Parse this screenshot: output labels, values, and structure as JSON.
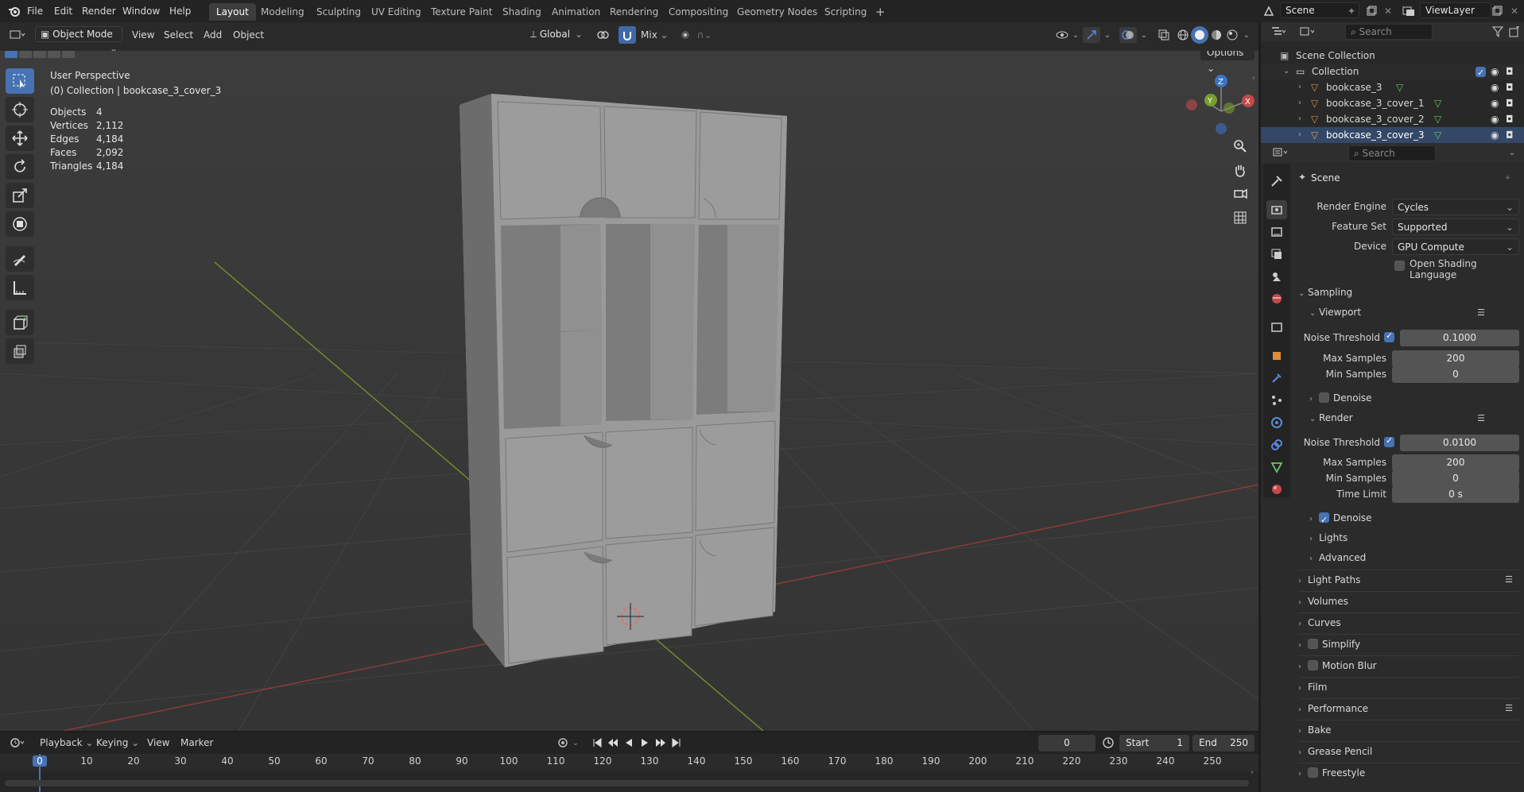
{
  "menus": [
    "File",
    "Edit",
    "Render",
    "Window",
    "Help"
  ],
  "workspaces": [
    "Layout",
    "Modeling",
    "Sculpting",
    "UV Editing",
    "Texture Paint",
    "Shading",
    "Animation",
    "Rendering",
    "Compositing",
    "Geometry Nodes",
    "Scripting"
  ],
  "scene_name": "Scene",
  "view_layer": "ViewLayer",
  "header": {
    "mode": "Object Mode",
    "view": "View",
    "select": "Select",
    "add": "Add",
    "object": "Object",
    "orientation": "Global",
    "pivot": "Mix",
    "options": "Options"
  },
  "overlay": {
    "perspective": "User Perspective",
    "collection": "(0) Collection | bookcase_3_cover_3"
  },
  "stats": [
    {
      "label": "Objects",
      "value": "4"
    },
    {
      "label": "Vertices",
      "value": "2,112"
    },
    {
      "label": "Edges",
      "value": "4,184"
    },
    {
      "label": "Faces",
      "value": "2,092"
    },
    {
      "label": "Triangles",
      "value": "4,184"
    }
  ],
  "outliner": {
    "search_placeholder": "Search",
    "root": "Scene Collection",
    "collection": "Collection",
    "items": [
      "bookcase_3",
      "bookcase_3_cover_1",
      "bookcase_3_cover_2",
      "bookcase_3_cover_3"
    ]
  },
  "properties": {
    "search_placeholder": "Search",
    "title": "Scene",
    "render_engine_label": "Render Engine",
    "render_engine": "Cycles",
    "feature_set_label": "Feature Set",
    "feature_set": "Supported",
    "device_label": "Device",
    "device": "GPU Compute",
    "osl_label": "Open Shading Language",
    "sampling": "Sampling",
    "viewport": "Viewport",
    "noise_threshold_label": "Noise Threshold",
    "vp_noise": "0.1000",
    "max_samples_label": "Max Samples",
    "vp_max": "200",
    "min_samples_label": "Min Samples",
    "vp_min": "0",
    "denoise_label": "Denoise",
    "render": "Render",
    "r_noise": "0.0100",
    "r_max": "200",
    "r_min": "0",
    "time_limit_label": "Time Limit",
    "r_time": "0 s",
    "lights": "Lights",
    "advanced": "Advanced",
    "sections": [
      "Light Paths",
      "Volumes",
      "Curves",
      "Simplify",
      "Motion Blur",
      "Film",
      "Performance",
      "Bake",
      "Grease Pencil",
      "Freestyle"
    ]
  },
  "timeline": {
    "playback": "Playback",
    "keying": "Keying",
    "view": "View",
    "marker": "Marker",
    "current": "0",
    "start_label": "Start",
    "start": "1",
    "end_label": "End",
    "end": "250",
    "ticks": [
      "0",
      "10",
      "20",
      "30",
      "40",
      "50",
      "60",
      "70",
      "80",
      "90",
      "100",
      "110",
      "120",
      "130",
      "140",
      "150",
      "160",
      "170",
      "180",
      "190",
      "200",
      "210",
      "220",
      "230",
      "240",
      "250"
    ]
  },
  "colors": {
    "accent": "#4772b3",
    "x_axis": "#8b3a3a",
    "y_axis": "#6e8a2e",
    "z_axis": "#3d73c4",
    "playhead": "#4772b3"
  },
  "icons": [
    "select-box-icon",
    "cursor-icon",
    "move-icon",
    "rotate-icon",
    "scale-icon",
    "transform-icon",
    "annotate-icon",
    "measure-icon",
    "add-cube-icon",
    "zoom-icon",
    "hand-icon",
    "camera-icon",
    "grid-icon",
    "eye-icon",
    "camera-render-icon",
    "mesh-icon"
  ]
}
